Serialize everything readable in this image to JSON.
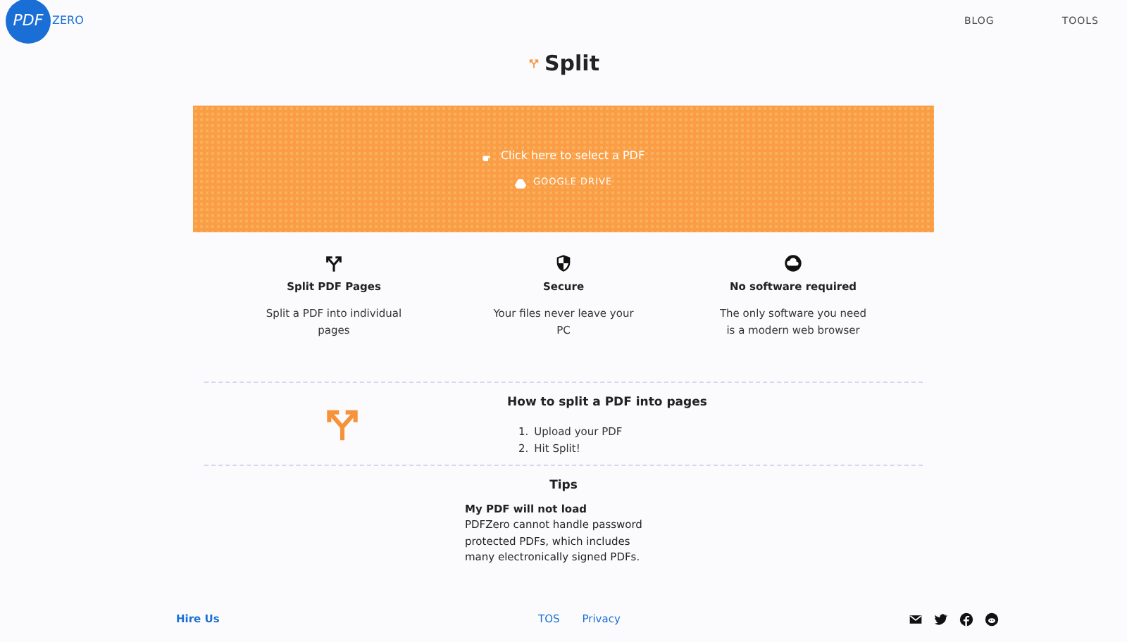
{
  "logo": {
    "primary": "PDF",
    "secondary": "ZERO"
  },
  "nav": [
    "BLOG",
    "TOOLS"
  ],
  "title": "Split",
  "dropzone": {
    "prompt": "Click here to select a PDF",
    "drive": "GOOGLE DRIVE"
  },
  "features": [
    {
      "title": "Split PDF Pages",
      "text": "Split a PDF into individual pages"
    },
    {
      "title": "Secure",
      "text": "Your files never leave your PC"
    },
    {
      "title": "No software required",
      "text": "The only software you need is a modern web browser"
    }
  ],
  "howto": {
    "title": "How to split a PDF into pages",
    "steps": [
      {
        "number": "1.",
        "text": "Upload your PDF"
      },
      {
        "number": "2.",
        "text": "Hit Split!"
      }
    ]
  },
  "tips": {
    "title": "Tips",
    "items": [
      {
        "question": "My PDF will not load",
        "answer": "PDFZero cannot handle password protected PDFs, which includes many electronically signed PDFs."
      }
    ]
  },
  "footer": {
    "hire": "Hire Us",
    "links": [
      "TOS",
      "Privacy"
    ]
  }
}
